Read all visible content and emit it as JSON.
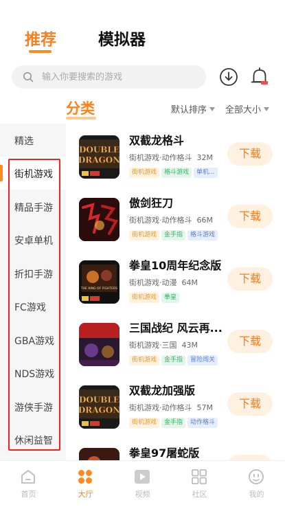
{
  "top_tabs": {
    "recommended": "推荐",
    "emulator": "模拟器"
  },
  "search": {
    "placeholder": "输入你要搜索的游戏"
  },
  "category": {
    "title": "分类",
    "sort_default": "默认排序",
    "sort_size": "全部大小"
  },
  "sidebar": {
    "items": [
      "精选",
      "街机游戏",
      "精品手游",
      "安卓单机",
      "折扣手游",
      "FC游戏",
      "GBA游戏",
      "NDS游戏",
      "游侠手游",
      "休闲益智"
    ],
    "active_index": 1
  },
  "games": [
    {
      "name": "双截龙格斗",
      "meta": "街机游戏·动作格斗",
      "size": "32M",
      "tags": [
        "街机游戏",
        "格斗游戏",
        "单机..."
      ],
      "button": "下载"
    },
    {
      "name": "傲剑狂刀",
      "meta": "街机游戏·动作格斗",
      "size": "66M",
      "tags": [
        "街机游戏",
        "金手指",
        "格斗游戏"
      ],
      "button": "下载"
    },
    {
      "name": "拳皇10周年纪念版",
      "meta": "街机游戏·动漫",
      "size": "64M",
      "tags": [
        "街机游戏",
        "拳皇"
      ],
      "button": "下载"
    },
    {
      "name": "三国战纪 风云再...",
      "meta": "街机游戏·三国",
      "size": "43M",
      "tags": [
        "街机游戏",
        "金手指",
        "冒险闯关"
      ],
      "button": "下载"
    },
    {
      "name": "双截龙加强版",
      "meta": "街机游戏·动作格斗",
      "size": "57M",
      "tags": [
        "街机游戏",
        "金手指",
        "动作格斗"
      ],
      "button": "下载"
    },
    {
      "name": "拳皇97屠蛇版",
      "meta": "",
      "size": "",
      "tags": [],
      "button": "下载"
    }
  ],
  "tag_colors": {
    "街机游戏": "orange",
    "格斗游戏": "green",
    "单机...": "blue",
    "金手指": "green",
    "拳皇": "green",
    "冒险闯关": "blue",
    "动作格斗": "blue"
  },
  "thumb_texts": {
    "double_dragon": [
      "DOUBLE",
      "DRAGON"
    ],
    "kof": "THE KING OF FIGHTERS"
  },
  "bottom_nav": [
    {
      "label": "首页",
      "icon": "home-icon"
    },
    {
      "label": "大厅",
      "icon": "hall-icon"
    },
    {
      "label": "视频",
      "icon": "video-icon"
    },
    {
      "label": "社区",
      "icon": "community-icon"
    },
    {
      "label": "我的",
      "icon": "profile-icon"
    }
  ],
  "bottom_nav_active": 1,
  "colors": {
    "accent": "#ff7f1a",
    "highlight_box": "#ee2222"
  }
}
